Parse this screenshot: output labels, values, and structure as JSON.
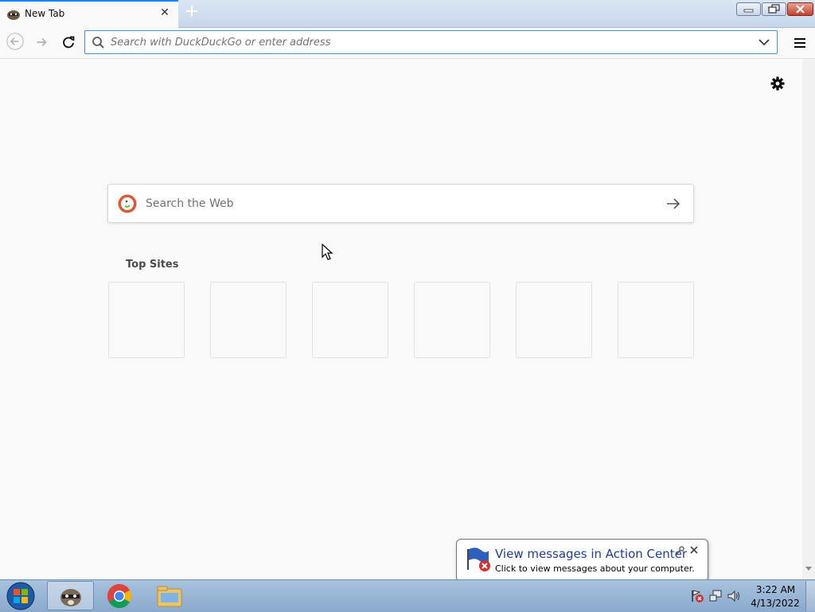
{
  "browser": {
    "tab_title": "New Tab",
    "new_tab_label": "+",
    "url_placeholder": "Search with DuckDuckGo or enter address"
  },
  "newtab": {
    "search_placeholder": "Search the Web",
    "top_sites_label": "Top Sites",
    "top_sites": [
      "",
      "",
      "",
      "",
      "",
      ""
    ]
  },
  "notification": {
    "title": "View messages in Action Center",
    "text": "Click to view messages about your computer."
  },
  "taskbar": {
    "time": "3:22 AM",
    "date": "4/13/2022",
    "pinned": [
      "browser-raccoon-icon",
      "chrome-icon",
      "file-explorer-icon"
    ]
  },
  "colors": {
    "accent": "#0a84ff",
    "balloon_title": "#1e3e9e",
    "ddg_orange": "#de5833"
  }
}
